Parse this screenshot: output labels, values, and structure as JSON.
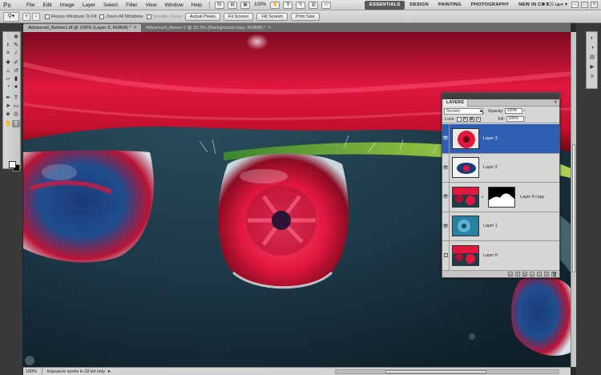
{
  "app": {
    "logo": "Ps"
  },
  "menu": [
    "File",
    "Edit",
    "Image",
    "Layer",
    "Select",
    "Filter",
    "View",
    "Window",
    "Help"
  ],
  "menubar_tools": {
    "zoom": "100%"
  },
  "workspaces": {
    "items": [
      "ESSENTIALS",
      "DESIGN",
      "PAINTING",
      "PHOTOGRAPHY",
      "NEW IN CS 5"
    ],
    "active": "ESSENTIALS",
    "more": "»",
    "cs_live": "CS Live"
  },
  "options_bar": {
    "resize_windows": "Resize Windows To Fit",
    "zoom_all_windows": "Zoom All Windows",
    "scrubby_zoom": "Scrubby Zoom",
    "actual_pixels": "Actual Pixels",
    "fit_screen": "Fit Screen",
    "fill_screen": "Fill Screen",
    "print_size": "Print Size"
  },
  "document_tabs": [
    {
      "label": "Advanced_Before1.tif @ 100% (Layer 3, RGB/8) *",
      "active": true
    },
    {
      "label": "Advanced_flower-2 @ 33.3% (Background copy, RGB/8) *",
      "active": false
    }
  ],
  "status_bar": {
    "zoom": "100%",
    "info": "Exposure works in 32-bit only"
  },
  "layers_panel": {
    "title": "LAYERS",
    "blend_mode": "Screen",
    "opacity_label": "Opacity:",
    "opacity_value": "100%",
    "lock_label": "Lock:",
    "fill_label": "Fill:",
    "fill_value": "100%",
    "layers": [
      {
        "name": "Layer 3",
        "selected": true,
        "visible": true,
        "has_mask": false
      },
      {
        "name": "Layer 2",
        "selected": false,
        "visible": true,
        "has_mask": false
      },
      {
        "name": "Layer 0 copy",
        "selected": false,
        "visible": true,
        "has_mask": true
      },
      {
        "name": "Layer 1",
        "selected": false,
        "visible": true,
        "has_mask": false
      },
      {
        "name": "Layer 0",
        "selected": false,
        "visible": false,
        "has_mask": false
      }
    ]
  },
  "colors": {
    "selected_layer": "#2f5fb5",
    "petal_red": "#e0173f",
    "background_teal": "#1f3b4a"
  }
}
